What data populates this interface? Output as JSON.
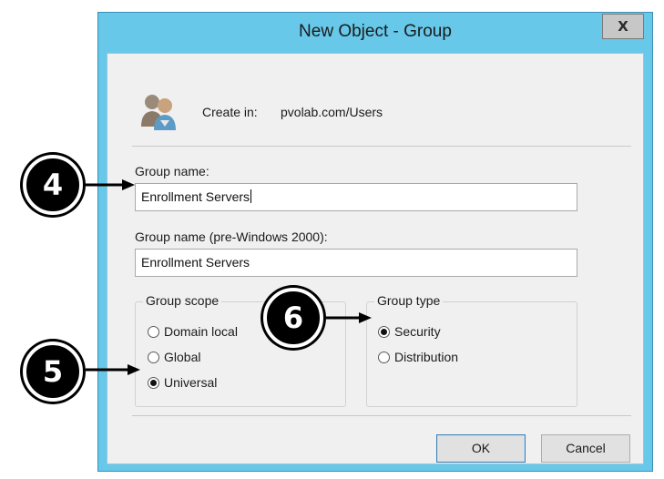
{
  "window": {
    "title": "New Object - Group",
    "close_label": "X"
  },
  "create_in": {
    "label": "Create in:",
    "value": "pvolab.com/Users"
  },
  "group_name": {
    "label": "Group name:",
    "value": "Enrollment Servers"
  },
  "group_name_pre2000": {
    "label": "Group name (pre-Windows 2000):",
    "value": "Enrollment Servers"
  },
  "group_scope": {
    "title": "Group scope",
    "options": [
      {
        "label": "Domain local",
        "checked": false
      },
      {
        "label": "Global",
        "checked": false
      },
      {
        "label": "Universal",
        "checked": true
      }
    ]
  },
  "group_type": {
    "title": "Group type",
    "options": [
      {
        "label": "Security",
        "checked": true
      },
      {
        "label": "Distribution",
        "checked": false
      }
    ]
  },
  "buttons": {
    "ok": "OK",
    "cancel": "Cancel"
  },
  "callouts": {
    "step4": "4",
    "step5": "5",
    "step6": "6"
  }
}
